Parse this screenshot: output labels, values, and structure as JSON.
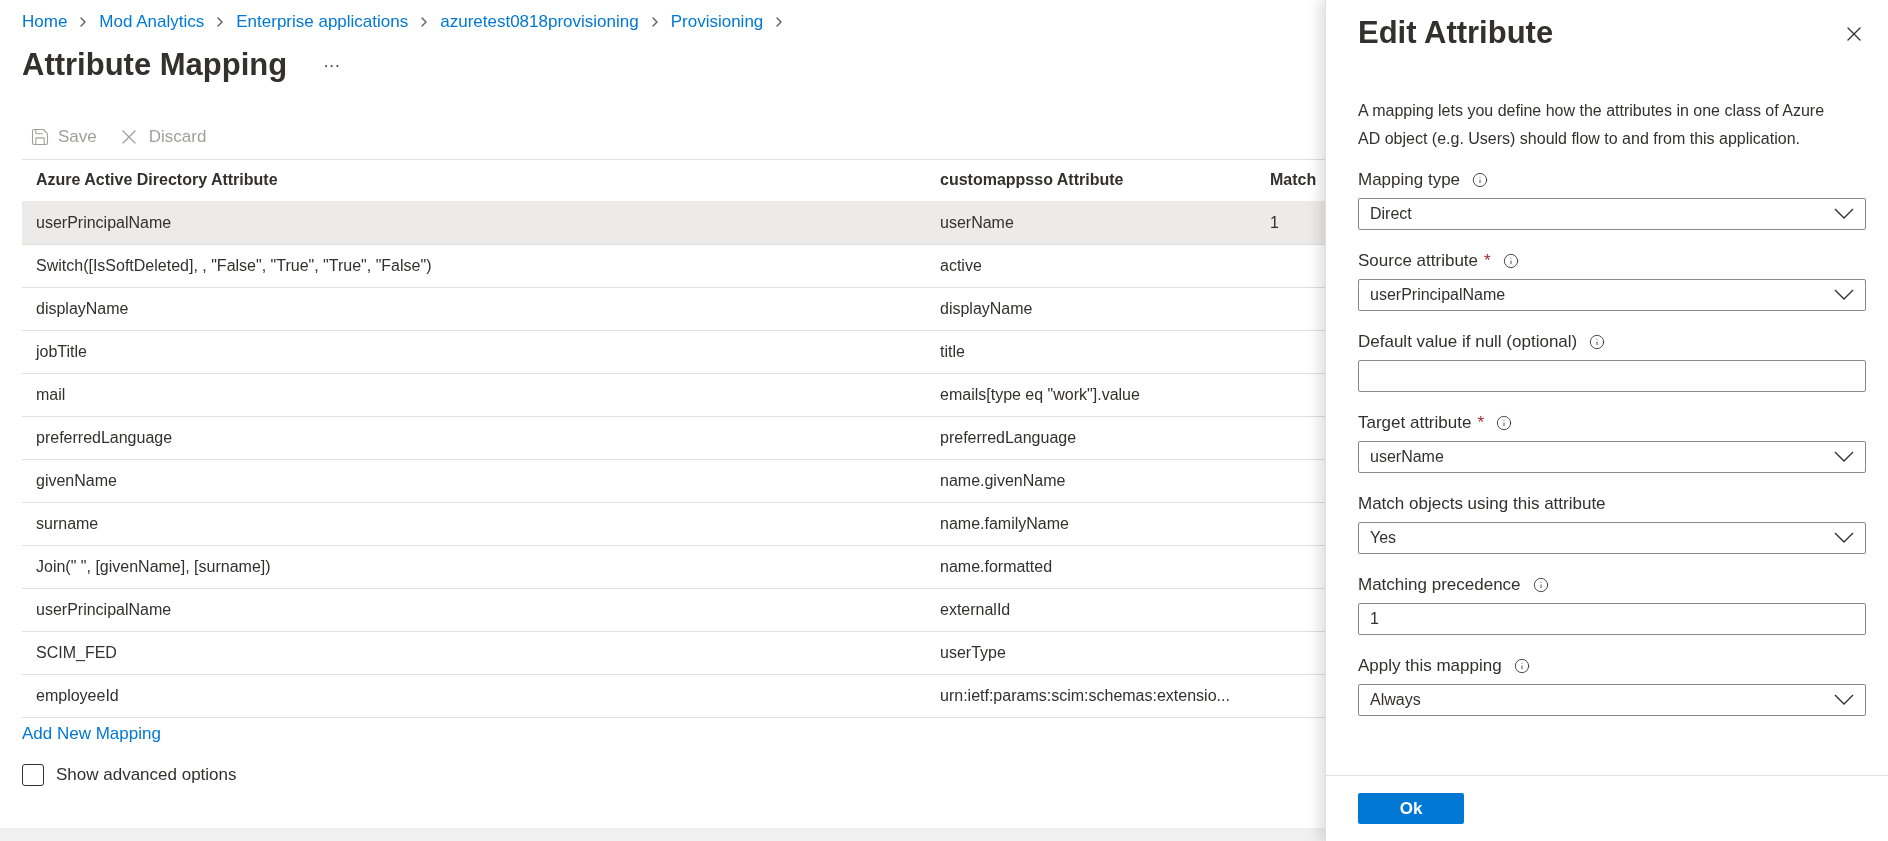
{
  "breadcrumb": [
    "Home",
    "Mod Analytics",
    "Enterprise applications",
    "azuretest0818provisioning",
    "Provisioning"
  ],
  "page": {
    "title": "Attribute Mapping",
    "more": "···"
  },
  "toolbar": [
    {
      "kind": "save",
      "label": "Save",
      "disabled": true
    },
    {
      "kind": "discard",
      "label": "Discard",
      "disabled": true
    }
  ],
  "table": {
    "columns": [
      "Azure Active Directory Attribute",
      "customappsso Attribute",
      "Match"
    ],
    "rows": [
      {
        "source": "userPrincipalName",
        "target": "userName",
        "match": "1",
        "selected": true
      },
      {
        "source": "Switch([IsSoftDeleted], , \"False\", \"True\", \"True\", \"False\")",
        "target": "active",
        "selected": false
      },
      {
        "source": "displayName",
        "target": "displayName",
        "selected": false
      },
      {
        "source": "jobTitle",
        "target": "title",
        "selected": false
      },
      {
        "source": "mail",
        "target": "emails[type eq \"work\"].value",
        "selected": false
      },
      {
        "source": "preferredLanguage",
        "target": "preferredLanguage",
        "selected": false
      },
      {
        "source": "givenName",
        "target": "name.givenName",
        "selected": false
      },
      {
        "source": "surname",
        "target": "name.familyName",
        "selected": false
      },
      {
        "source": "Join(\" \", [givenName], [surname])",
        "target": "name.formatted",
        "selected": false
      },
      {
        "source": "userPrincipalName",
        "target": "externalId",
        "selected": false
      },
      {
        "source": "SCIM_FED",
        "target": "userType",
        "selected": false
      },
      {
        "source": "employeeId",
        "target": "urn:ietf:params:scim:schemas:extensio...",
        "selected": false
      }
    ]
  },
  "add_link": "Add New Mapping",
  "advanced": {
    "label": "Show advanced options",
    "checked": false
  },
  "panel": {
    "title": "Edit Attribute",
    "description": "A mapping lets you define how the attributes in one class of Azure AD object (e.g. Users) should flow to and from this application.",
    "fields": [
      {
        "kind": "select",
        "label": "Mapping type",
        "info": true,
        "value": "Direct"
      },
      {
        "kind": "select",
        "label": "Source attribute",
        "required_mark": "*",
        "info": true,
        "value": "userPrincipalName"
      },
      {
        "kind": "text",
        "label": "Default value if null (optional)",
        "info": true
      },
      {
        "kind": "select",
        "label": "Target attribute",
        "required_mark": "*",
        "info": true,
        "value": "userName"
      },
      {
        "kind": "select",
        "label": "Match objects using this attribute",
        "info": false,
        "value": "Yes"
      },
      {
        "kind": "text",
        "label": "Matching precedence",
        "info": true,
        "value": "1"
      },
      {
        "kind": "select",
        "label": "Apply this mapping",
        "info": true,
        "value": "Always"
      }
    ],
    "ok": "Ok"
  }
}
